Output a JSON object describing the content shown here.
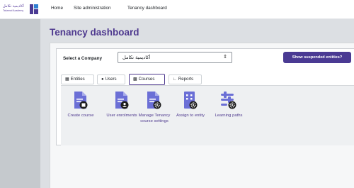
{
  "brand": {
    "logo_arabic": "أكاديمية تكامل",
    "logo_english": "Takamol Academy"
  },
  "navbar": {
    "items": [
      {
        "label": "Home"
      },
      {
        "label": "Site administration"
      },
      {
        "label": "Tenancy dashboard"
      }
    ]
  },
  "page": {
    "title": "Tenancy dashboard"
  },
  "company_filter": {
    "label": "Select a Company",
    "selected_value": "أكاديمية تكامل"
  },
  "actions": {
    "show_suspended_label": "Show suspended entities?"
  },
  "tabs": [
    {
      "label": "Entities",
      "icon": "building-icon"
    },
    {
      "label": "Users",
      "icon": "user-icon"
    },
    {
      "label": "Courses",
      "icon": "book-icon",
      "active": true
    },
    {
      "label": "Reports",
      "icon": "chart-icon"
    }
  ],
  "course_actions": [
    {
      "label": "Create course",
      "icon": "file-add-icon"
    },
    {
      "label": "User enrolments",
      "icon": "file-user-icon"
    },
    {
      "label": "Manage Tenancy course settings",
      "icon": "file-gear-icon"
    },
    {
      "label": "Assign to entity",
      "icon": "building-gear-icon"
    },
    {
      "label": "Learning paths",
      "icon": "path-gear-icon"
    }
  ],
  "colors": {
    "accent": "#4f3a8f",
    "button": "#4a3a93",
    "icon": "#6b6fd6"
  }
}
